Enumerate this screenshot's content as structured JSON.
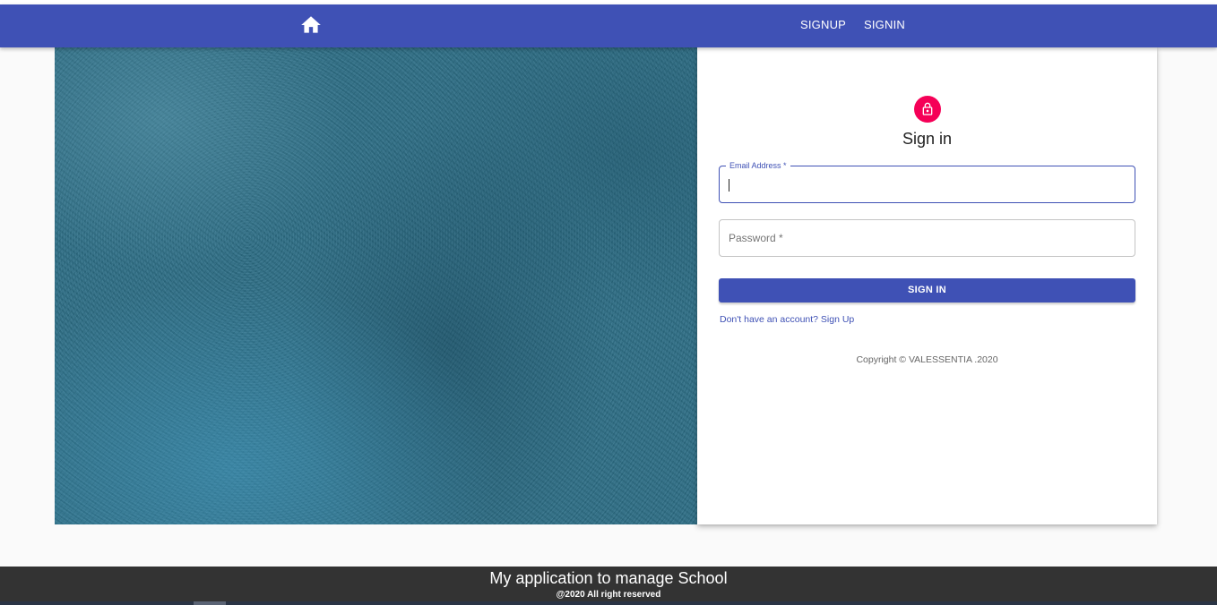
{
  "navbar": {
    "home_icon": "home-icon",
    "links": [
      "SIGNUP",
      "SIGNIN"
    ],
    "color": "#3f51b5"
  },
  "form": {
    "lock_icon": "lock-open-icon",
    "avatar_color": "#f50057",
    "title": "Sign in",
    "email": {
      "label": "Email Address *",
      "value": ""
    },
    "password": {
      "placeholder": "Password *",
      "value": ""
    },
    "submit_label": "SIGN IN",
    "signup_link": "Don't have an account? Sign Up",
    "copyright": "Copyright © VALESSENTIA .2020"
  },
  "footer": {
    "title": "My application to manage School",
    "subtitle": "@2020 All right reserved"
  }
}
